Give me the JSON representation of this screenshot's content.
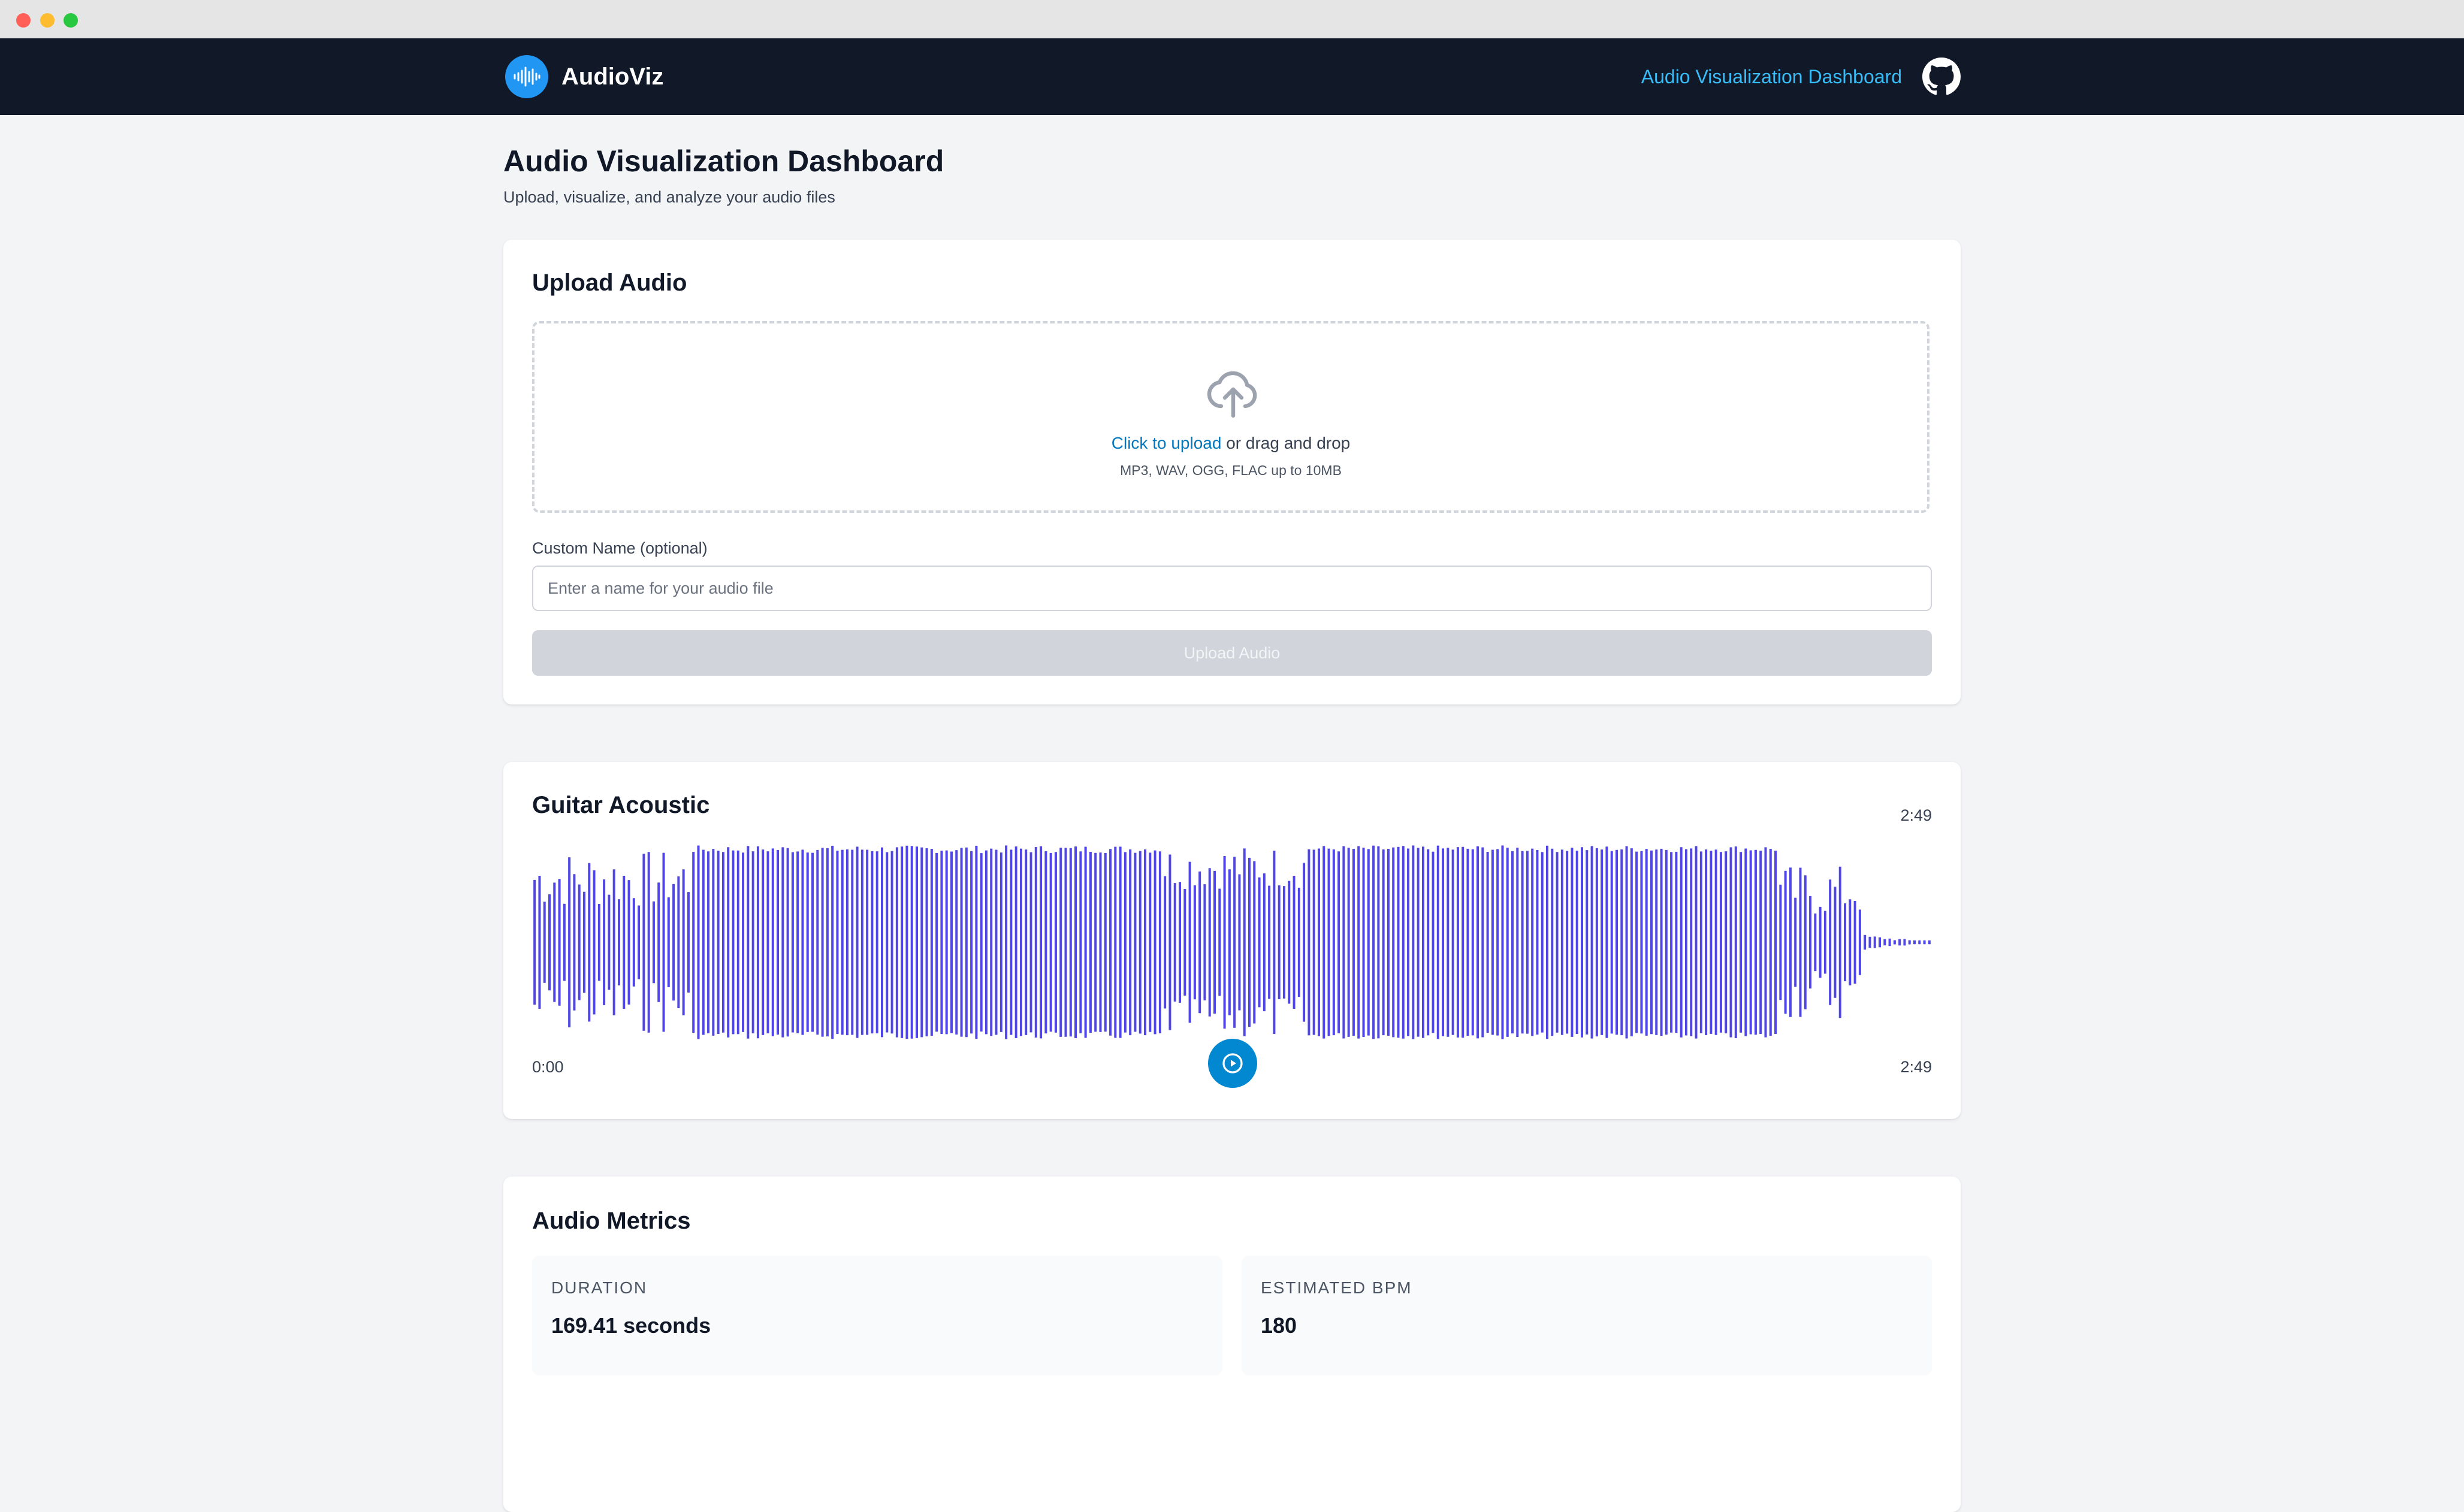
{
  "brand": {
    "name": "AudioViz"
  },
  "nav": {
    "link_label": "Audio Visualization Dashboard",
    "github_icon": "github-icon"
  },
  "page": {
    "title": "Audio Visualization Dashboard",
    "subtitle": "Upload, visualize, and analyze your audio files"
  },
  "upload": {
    "title": "Upload Audio",
    "click_label": "Click to upload",
    "drag_label": " or drag and drop",
    "hint": "MP3, WAV, OGG, FLAC up to 10MB",
    "name_label": "Custom Name (optional)",
    "name_value": "",
    "name_placeholder": "Enter a name for your audio file",
    "button_label": "Upload Audio",
    "icon": "cloud-upload-icon"
  },
  "player": {
    "track_title": "Guitar Acoustic",
    "duration": "2:49",
    "current_time": "0:00",
    "end_time": "2:49",
    "waveform_color": "#4f46e5",
    "play_button_color": "#0288d1",
    "icon": "play-icon"
  },
  "metrics": {
    "title": "Audio Metrics",
    "items": [
      {
        "label": "DURATION",
        "value": "169.41 seconds"
      },
      {
        "label": "ESTIMATED BPM",
        "value": "180"
      }
    ]
  },
  "colors": {
    "navbar_bg": "#111827",
    "brand_accent": "#2196f3",
    "link": "#38bdf8",
    "page_bg": "#f3f4f6"
  }
}
